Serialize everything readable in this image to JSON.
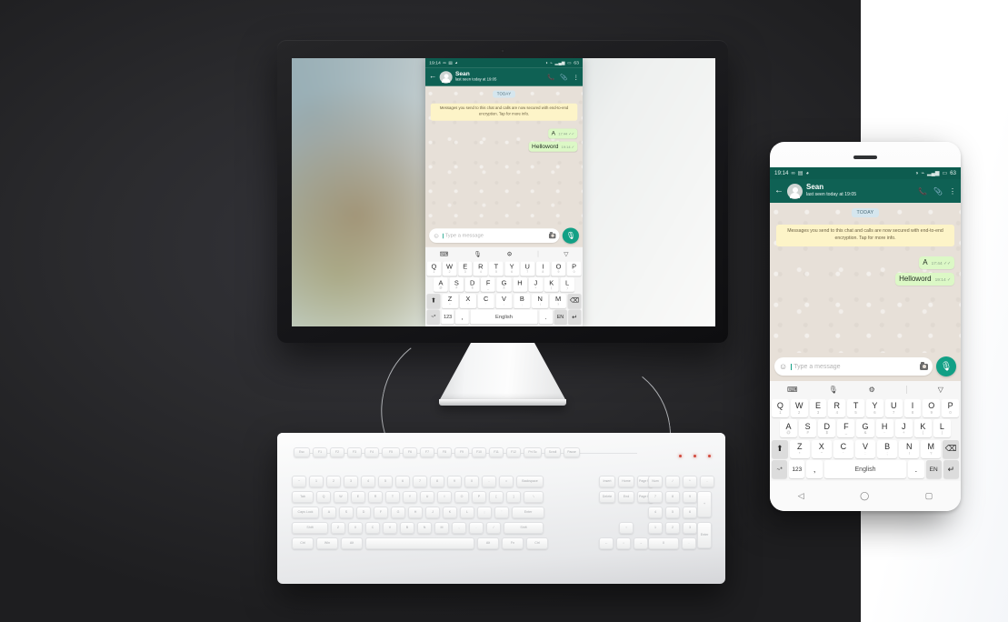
{
  "scene": {
    "background_color": "#2a2a2c",
    "panel_color": "#ffffff"
  },
  "whatsapp": {
    "status_bar": {
      "time": "19:14",
      "left_icons": [
        "infinity-icon",
        "gallery-icon",
        "message-icon"
      ],
      "right_icons": [
        "headset-icon",
        "wifi-icon",
        "signal-icon",
        "battery-icon"
      ],
      "battery_level": "63"
    },
    "header": {
      "back_icon": "←",
      "contact_name": "Sean",
      "contact_status": "last seen today at 19:05",
      "call_icon": "📞",
      "attach_icon": "📎",
      "menu_icon": "⋮"
    },
    "conversation": {
      "day_divider": "TODAY",
      "encryption_notice": "Messages you send to this chat and calls are now secured with end-to-end encryption. Tap for more info.",
      "messages": [
        {
          "text": "A",
          "time": "17:44",
          "ticks": "✓✓",
          "outgoing": true
        },
        {
          "text": "Helloword",
          "time": "19:14",
          "ticks": "✓",
          "outgoing": true
        }
      ]
    },
    "input_bar": {
      "emoji_icon": "☺",
      "placeholder": "Type a message",
      "camera_icon": "camera-icon",
      "mic_icon": "🎤"
    }
  },
  "virtual_keyboard": {
    "toolbar": [
      {
        "icon": "keyboard-icon",
        "glyph": "⌨"
      },
      {
        "icon": "microphone-icon",
        "glyph": "🎙"
      },
      {
        "icon": "settings-gear-icon",
        "glyph": "⚙"
      },
      {
        "icon": "collapse-chevron-icon",
        "glyph": "▽"
      }
    ],
    "row1": [
      {
        "key": "Q",
        "alt": "1"
      },
      {
        "key": "W",
        "alt": "2"
      },
      {
        "key": "E",
        "alt": "3"
      },
      {
        "key": "R",
        "alt": "4"
      },
      {
        "key": "T",
        "alt": "5"
      },
      {
        "key": "Y",
        "alt": "6"
      },
      {
        "key": "U",
        "alt": "7"
      },
      {
        "key": "I",
        "alt": "8"
      },
      {
        "key": "O",
        "alt": "9"
      },
      {
        "key": "P",
        "alt": "0"
      }
    ],
    "row2": [
      {
        "key": "A",
        "alt": "@"
      },
      {
        "key": "S",
        "alt": "#"
      },
      {
        "key": "D",
        "alt": "$"
      },
      {
        "key": "F",
        "alt": "_"
      },
      {
        "key": "G",
        "alt": "&"
      },
      {
        "key": "H",
        "alt": "-"
      },
      {
        "key": "J",
        "alt": "+"
      },
      {
        "key": "K",
        "alt": "("
      },
      {
        "key": "L",
        "alt": ")"
      }
    ],
    "row3": [
      {
        "key": "Z",
        "alt": "*"
      },
      {
        "key": "X",
        "alt": "\""
      },
      {
        "key": "C",
        "alt": "'"
      },
      {
        "key": "V",
        "alt": ":"
      },
      {
        "key": "B",
        "alt": ";"
      },
      {
        "key": "N",
        "alt": "!"
      },
      {
        "key": "M",
        "alt": "?"
      }
    ],
    "shift_key": "⬆",
    "backspace_key": "⌫",
    "row4": {
      "symbols_key": "~*",
      "numbers_key": "123",
      "comma_key": ",",
      "space_key": "English",
      "period_key": ".",
      "lang_key": "EN",
      "enter_key": "↵"
    }
  },
  "phone_navbar": {
    "back_icon": "◁",
    "home_icon": "◯",
    "recents_icon": "▢"
  },
  "physical_keyboard": {
    "fn_row": [
      "Esc",
      "F1",
      "F2",
      "F3",
      "F4",
      "F5",
      "F6",
      "F7",
      "F8",
      "F9",
      "F10",
      "F11",
      "F12",
      "Prt Sc",
      "Scroll",
      "Pause"
    ],
    "num_row": [
      "~",
      "1",
      "2",
      "3",
      "4",
      "5",
      "6",
      "7",
      "8",
      "9",
      "0",
      "-",
      "=",
      "Backspace"
    ],
    "row_q": [
      "Tab",
      "Q",
      "W",
      "E",
      "R",
      "T",
      "Y",
      "U",
      "I",
      "O",
      "P",
      "[",
      "]",
      "\\"
    ],
    "row_a": [
      "Caps Lock",
      "A",
      "S",
      "D",
      "F",
      "G",
      "H",
      "J",
      "K",
      "L",
      ";",
      "'",
      "Enter"
    ],
    "row_z": [
      "Shift",
      "Z",
      "X",
      "C",
      "V",
      "B",
      "N",
      "M",
      ",",
      ".",
      "/",
      "Shift"
    ],
    "row_ctrl": [
      "Ctrl",
      "Win",
      "Alt",
      "",
      "Alt",
      "Fn",
      "Ctrl"
    ],
    "nav_cluster": [
      "Insert",
      "Home",
      "Page Up",
      "Delete",
      "End",
      "Page Dn"
    ],
    "numpad": [
      "Num",
      "/",
      "*",
      "-",
      "7",
      "8",
      "9",
      "4",
      "5",
      "6",
      "1",
      "2",
      "3",
      "+",
      "0",
      ".",
      "Enter"
    ],
    "arrows": [
      "↑",
      "←",
      "↓",
      "→"
    ],
    "led_color": "#d24b3e",
    "led_count": 3
  }
}
